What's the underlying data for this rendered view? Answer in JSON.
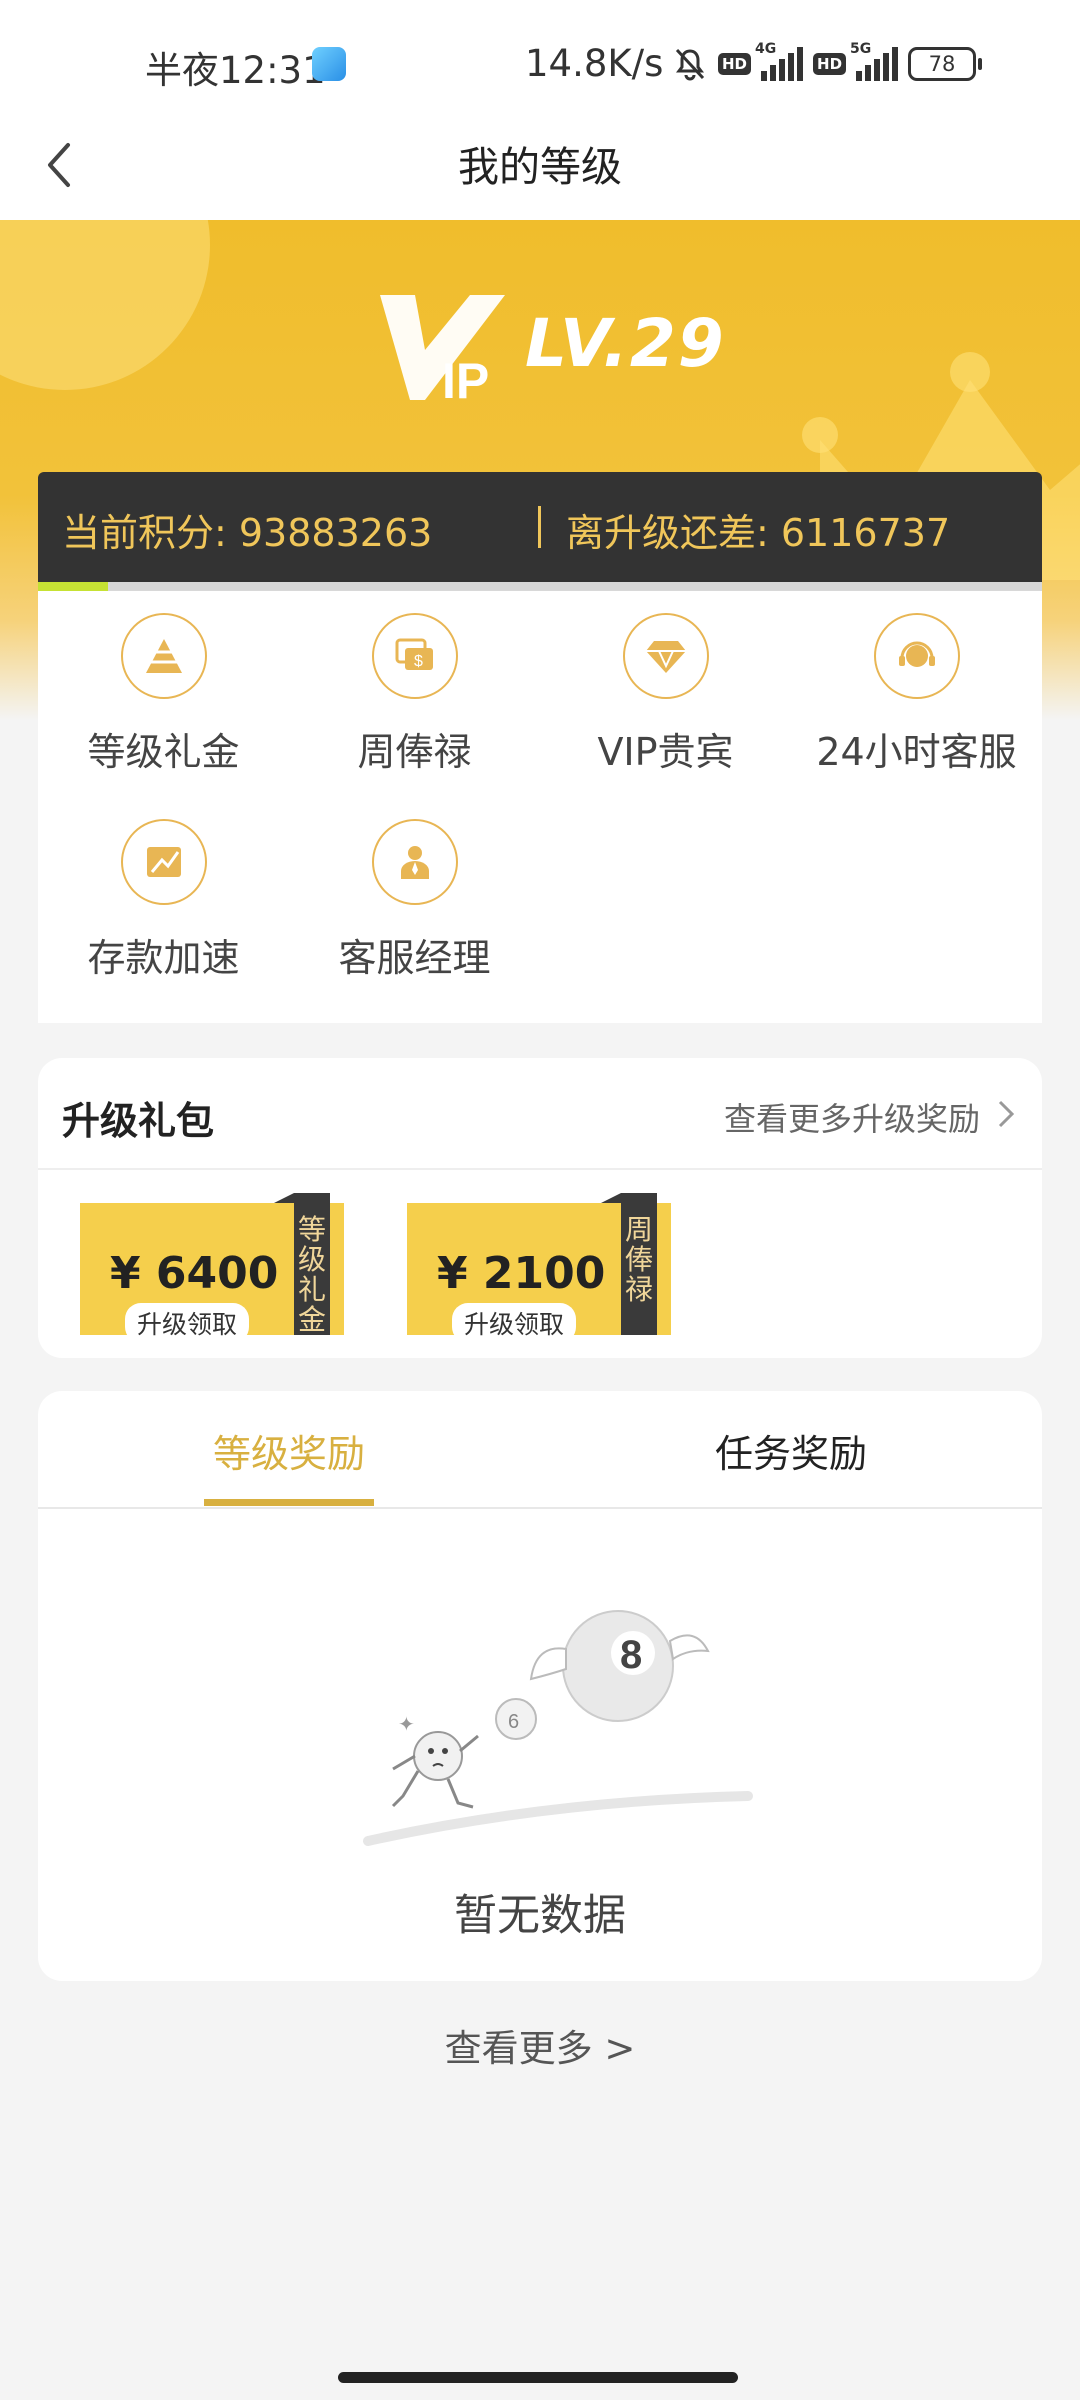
{
  "status_bar": {
    "time": "半夜12:31",
    "net_speed": "14.8K/s",
    "hd1": "HD",
    "net1": "4G",
    "hd2": "HD",
    "net2": "5G",
    "battery": "78"
  },
  "nav": {
    "title": "我的等级"
  },
  "vip": {
    "level": "LV.29",
    "points_label": "当前积分: 93883263",
    "gap_label": "离升级还差: 6116737",
    "accent": "#f0bd2c"
  },
  "privileges": [
    {
      "label": "等级礼金",
      "icon": "pyramid-icon"
    },
    {
      "label": "周俸禄",
      "icon": "money-icon"
    },
    {
      "label": "VIP贵宾",
      "icon": "diamond-icon"
    },
    {
      "label": "24小时客服",
      "icon": "headset-icon"
    },
    {
      "label": "存款加速",
      "icon": "speed-icon"
    },
    {
      "label": "客服经理",
      "icon": "manager-icon"
    }
  ],
  "package": {
    "title": "升级礼包",
    "more": "查看更多升级奖励",
    "coupons": [
      {
        "amount": "¥ 6400",
        "action": "升级领取",
        "type": "等级礼金"
      },
      {
        "amount": "¥ 2100",
        "action": "升级领取",
        "type": "周俸禄"
      }
    ]
  },
  "rewards": {
    "tabs": [
      "等级奖励",
      "任务奖励"
    ],
    "empty": "暂无数据"
  },
  "footer": {
    "see_more": "查看更多 >"
  }
}
